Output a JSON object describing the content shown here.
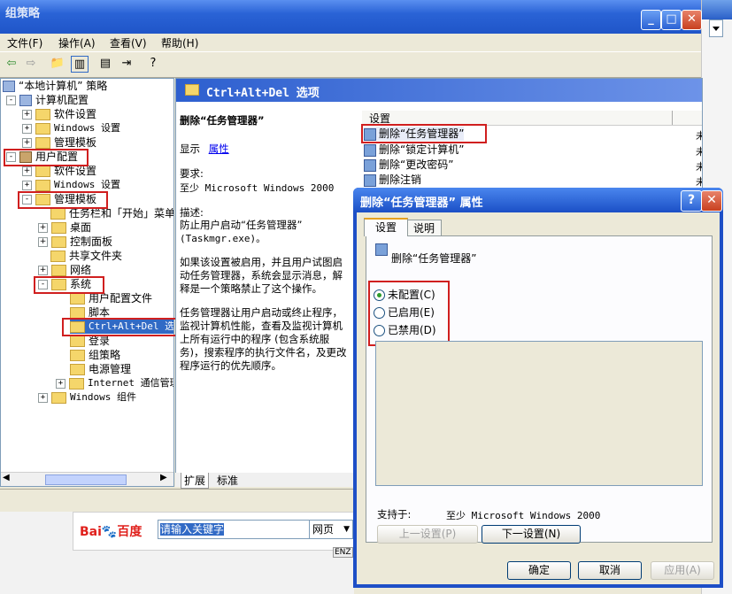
{
  "main_window": {
    "title": "组策略",
    "menu": [
      "文件(F)",
      "操作(A)",
      "查看(V)",
      "帮助(H)"
    ],
    "tree": [
      {
        "label": "“本地计算机” 策略",
        "indent": 0,
        "exp": ""
      },
      {
        "label": "计算机配置",
        "indent": 1,
        "exp": "-"
      },
      {
        "label": "软件设置",
        "indent": 2,
        "exp": "+"
      },
      {
        "label": "Windows 设置",
        "indent": 2,
        "exp": "+"
      },
      {
        "label": "管理模板",
        "indent": 2,
        "exp": "+"
      },
      {
        "label": "用户配置",
        "indent": 1,
        "exp": "-"
      },
      {
        "label": "软件设置",
        "indent": 2,
        "exp": "+"
      },
      {
        "label": "Windows 设置",
        "indent": 2,
        "exp": "+"
      },
      {
        "label": "管理模板",
        "indent": 2,
        "exp": "-"
      },
      {
        "label": "任务栏和「开始」菜单",
        "indent": 3,
        "exp": ""
      },
      {
        "label": "桌面",
        "indent": 3,
        "exp": "+"
      },
      {
        "label": "控制面板",
        "indent": 3,
        "exp": "+"
      },
      {
        "label": "共享文件夹",
        "indent": 3,
        "exp": ""
      },
      {
        "label": "网络",
        "indent": 3,
        "exp": "+"
      },
      {
        "label": "系统",
        "indent": 3,
        "exp": "-"
      },
      {
        "label": "用户配置文件",
        "indent": 4,
        "exp": ""
      },
      {
        "label": "脚本",
        "indent": 4,
        "exp": ""
      },
      {
        "label": "Ctrl+Alt+Del 选项",
        "indent": 4,
        "exp": ""
      },
      {
        "label": "登录",
        "indent": 4,
        "exp": ""
      },
      {
        "label": "组策略",
        "indent": 4,
        "exp": ""
      },
      {
        "label": "电源管理",
        "indent": 4,
        "exp": ""
      },
      {
        "label": "Internet 通信管理",
        "indent": 4,
        "exp": "+"
      },
      {
        "label": "Windows 组件",
        "indent": 3,
        "exp": "+"
      }
    ],
    "content_header": "Ctrl+Alt+Del 选项",
    "description": {
      "title": "删除“任务管理器”",
      "display_prefix": "显示",
      "properties_link": "属性",
      "requirements_label": "要求:",
      "requirements": "至少 Microsoft Windows 2000",
      "description_label": "描述:",
      "lines": [
        "防止用户启动“任务管理器”",
        "(Taskmgr.exe)。",
        "",
        "如果该设置被启用，并且用户试图启",
        "动任务管理器，系统会显示消息，解",
        "释是一个策略禁止了这个操作。",
        "",
        "任务管理器让用户启动或终止程序，",
        "监视计算机性能，查看及监视计算机",
        "上所有运行中的程序 (包含系统服",
        "务)，搜索程序的执行文件名，及更改",
        "程序运行的优先顺序。"
      ]
    },
    "list_header": "设置",
    "list_items": [
      "删除“任务管理器”",
      "删除“锁定计算机”",
      "删除“更改密码”",
      "删除注销"
    ],
    "list_state_glyph": "未",
    "bottom_tabs": [
      "扩展",
      "标准"
    ]
  },
  "baidu": {
    "logo_a": "Bai",
    "logo_b": "百度",
    "search_placeholder": "请输入关键字",
    "search_type": "网页",
    "enz": "ENZ"
  },
  "dialog": {
    "title": "删除“任务管理器” 属性",
    "tabs": [
      "设置",
      "说明"
    ],
    "setting_name": "删除“任务管理器”",
    "radios": [
      "未配置(C)",
      "已启用(E)",
      "已禁用(D)"
    ],
    "selected": 0,
    "supported_label": "支持于:",
    "supported_value": "至少 Microsoft Windows 2000",
    "prev_button": "上一设置(P)",
    "next_button": "下一设置(N)",
    "ok": "确定",
    "cancel": "取消",
    "apply": "应用(A)"
  }
}
